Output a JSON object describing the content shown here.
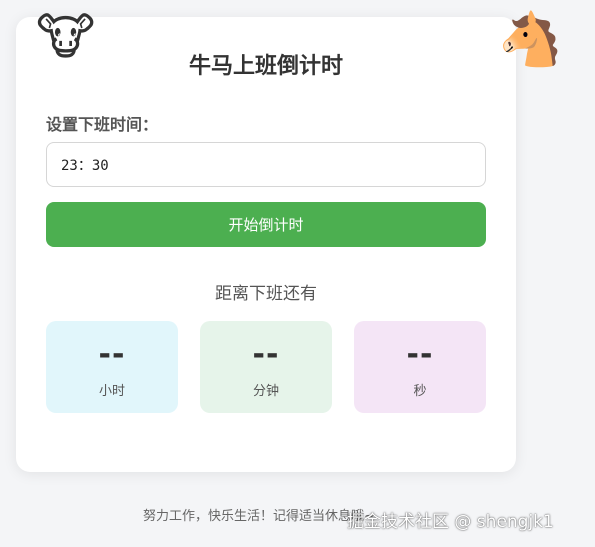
{
  "app": {
    "title": "牛马上班倒计时",
    "icons": {
      "left": "🐮",
      "right": "🐴"
    }
  },
  "settings": {
    "label": "设置下班时间：",
    "time_value": "23：30"
  },
  "actions": {
    "start_label": "开始倒计时"
  },
  "countdown": {
    "label": "距离下班还有",
    "hours": {
      "value": "--",
      "unit": "小时"
    },
    "minutes": {
      "value": "--",
      "unit": "分钟"
    },
    "seconds": {
      "value": "--",
      "unit": "秒"
    }
  },
  "footer": {
    "text": "努力工作，快乐生活！记得适当休息哦~"
  },
  "watermark": {
    "text": "掘金技术社区 @ shengjk1"
  },
  "colors": {
    "primary_button": "#4caf50",
    "hours_tile": "#e1f6fb",
    "minutes_tile": "#e6f4ea",
    "seconds_tile": "#f4e5f6"
  }
}
